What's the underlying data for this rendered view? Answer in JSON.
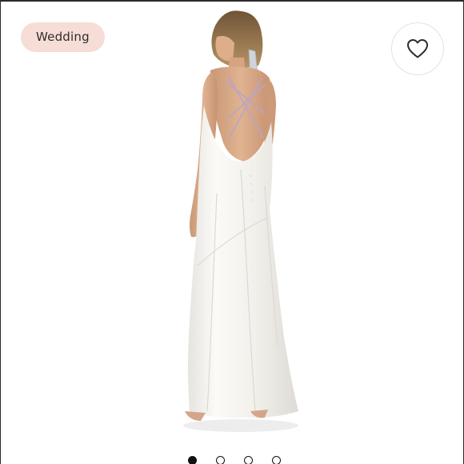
{
  "listing": {
    "category_tag": "Wedding",
    "like_icon": "heart-outline-icon",
    "image_subject": "woman-in-white-satin-backless-gown-photo"
  },
  "carousel": {
    "total_images": 4,
    "active_index": 0
  },
  "colors": {
    "tag_background": "#f6ddd6",
    "dot_active": "#111111",
    "dress": "#f7f6f2",
    "hair": "#8a6a45",
    "skin": "#d9aa86"
  }
}
